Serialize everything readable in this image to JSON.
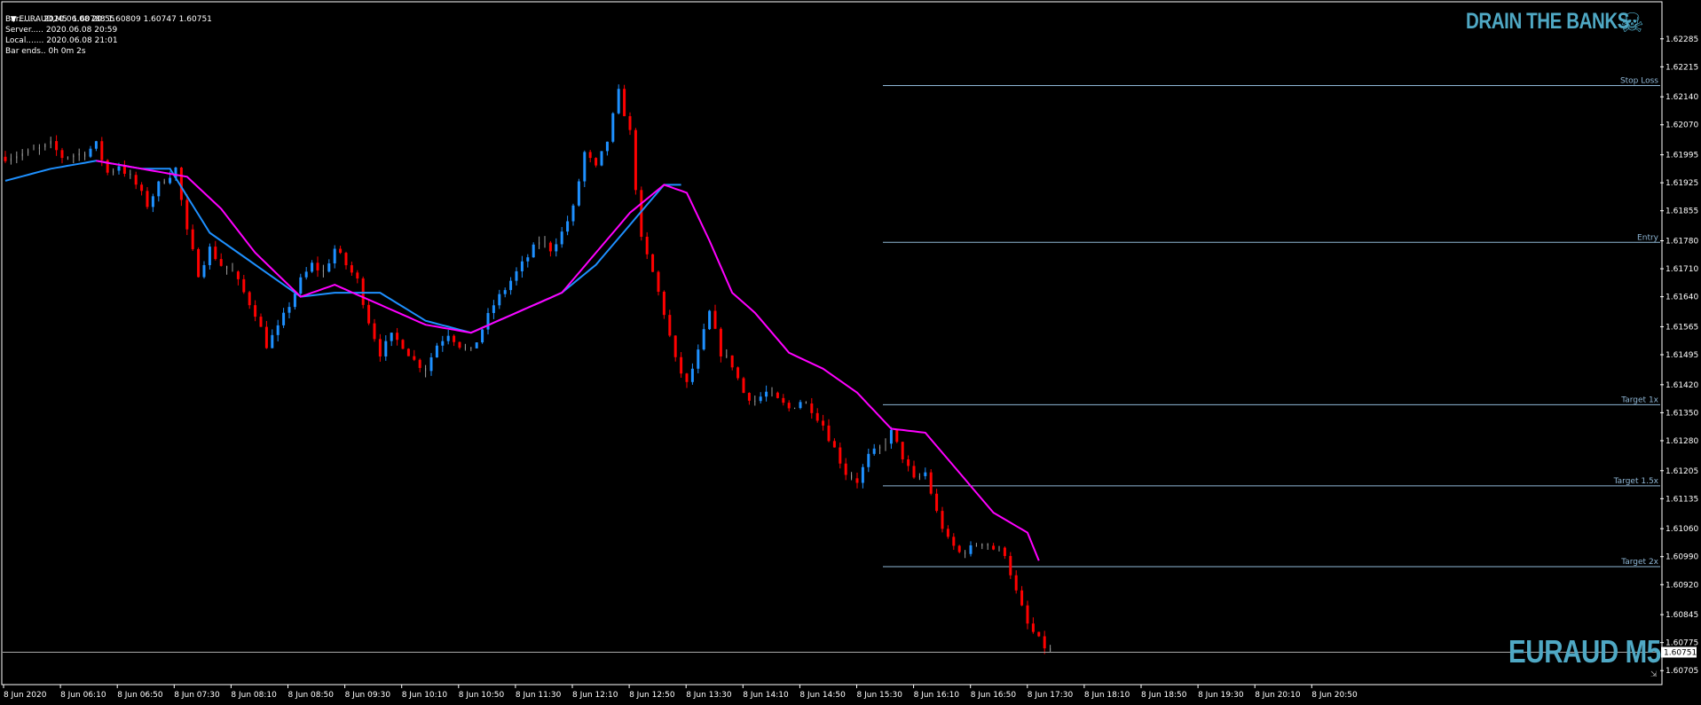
{
  "header": {
    "symbol_line": "EURAUD,M5  1.60788 1.60809 1.60747 1.60751",
    "bar": "Bar......... 2020.06.08 20:55",
    "server": "Server..... 2020.06.08 20:59",
    "local": "Local....... 2020.06.08 21:01",
    "bar_ends": "Bar ends.. 0h 0m 2s"
  },
  "branding": {
    "top": "DRAIN THE BANKS",
    "bottom": "EURAUD M5",
    "icon": "skull-crossbones-icon"
  },
  "colors": {
    "background": "#000000",
    "bull": "#1e90ff",
    "bear": "#ff0000",
    "neutral": "#a0a0a0",
    "ma_fast": "#1e90ff",
    "ma_slow": "#ff00ff",
    "level": "#8fb7d6",
    "brand": "#4fa8c4"
  },
  "chart_data": {
    "type": "candlestick",
    "symbol": "EURAUD",
    "timeframe": "M5",
    "y_ticks": [
      "1.62285",
      "1.62215",
      "1.62140",
      "1.62070",
      "1.61995",
      "1.61925",
      "1.61855",
      "1.61780",
      "1.61710",
      "1.61640",
      "1.61565",
      "1.61495",
      "1.61420",
      "1.61350",
      "1.61280",
      "1.61205",
      "1.61135",
      "1.61060",
      "1.60990",
      "1.60920",
      "1.60845",
      "1.60775",
      "1.60705"
    ],
    "x_ticks": [
      "8 Jun 2020",
      "8 Jun 06:10",
      "8 Jun 06:50",
      "8 Jun 07:30",
      "8 Jun 08:10",
      "8 Jun 08:50",
      "8 Jun 09:30",
      "8 Jun 10:10",
      "8 Jun 10:50",
      "8 Jun 11:30",
      "8 Jun 12:10",
      "8 Jun 12:50",
      "8 Jun 13:30",
      "8 Jun 14:10",
      "8 Jun 14:50",
      "8 Jun 15:30",
      "8 Jun 16:10",
      "8 Jun 16:50",
      "8 Jun 17:30",
      "8 Jun 18:10",
      "8 Jun 18:50",
      "8 Jun 19:30",
      "8 Jun 20:10",
      "8 Jun 20:50"
    ],
    "ylim": [
      1.6069,
      1.6232
    ],
    "current_price": "1.60751",
    "levels": [
      {
        "label": "Stop Loss",
        "price": 1.62168
      },
      {
        "label": "Entry",
        "price": 1.61776
      },
      {
        "label": "Target 1x",
        "price": 1.6137
      },
      {
        "label": "Target 1.5x",
        "price": 1.61167
      },
      {
        "label": "Target 2x",
        "price": 1.60965
      }
    ],
    "close_path": [
      [
        0,
        1.6199
      ],
      [
        4,
        1.62
      ],
      [
        8,
        1.6202
      ],
      [
        10,
        1.6199
      ],
      [
        14,
        1.62
      ],
      [
        16,
        1.6202
      ],
      [
        18,
        1.6195
      ],
      [
        20,
        1.6197
      ],
      [
        23,
        1.6192
      ],
      [
        25,
        1.6187
      ],
      [
        27,
        1.6192
      ],
      [
        30,
        1.6196
      ],
      [
        32,
        1.618
      ],
      [
        34,
        1.617
      ],
      [
        36,
        1.6176
      ],
      [
        38,
        1.6172
      ],
      [
        40,
        1.617
      ],
      [
        42,
        1.6165
      ],
      [
        44,
        1.616
      ],
      [
        46,
        1.6152
      ],
      [
        48,
        1.6156
      ],
      [
        50,
        1.6162
      ],
      [
        52,
        1.6168
      ],
      [
        54,
        1.6172
      ],
      [
        56,
        1.617
      ],
      [
        58,
        1.6176
      ],
      [
        60,
        1.6172
      ],
      [
        62,
        1.6168
      ],
      [
        64,
        1.6158
      ],
      [
        66,
        1.615
      ],
      [
        68,
        1.6154
      ],
      [
        70,
        1.6152
      ],
      [
        72,
        1.6148
      ],
      [
        74,
        1.6146
      ],
      [
        76,
        1.6152
      ],
      [
        78,
        1.6155
      ],
      [
        80,
        1.6152
      ],
      [
        82,
        1.615
      ],
      [
        84,
        1.6156
      ],
      [
        86,
        1.6162
      ],
      [
        88,
        1.6166
      ],
      [
        90,
        1.617
      ],
      [
        92,
        1.6174
      ],
      [
        94,
        1.6178
      ],
      [
        96,
        1.6176
      ],
      [
        98,
        1.618
      ],
      [
        100,
        1.6186
      ],
      [
        102,
        1.62
      ],
      [
        104,
        1.6196
      ],
      [
        106,
        1.6203
      ],
      [
        108,
        1.6215
      ],
      [
        110,
        1.6205
      ],
      [
        112,
        1.6178
      ],
      [
        114,
        1.617
      ],
      [
        116,
        1.616
      ],
      [
        118,
        1.6148
      ],
      [
        120,
        1.6142
      ],
      [
        122,
        1.615
      ],
      [
        124,
        1.616
      ],
      [
        126,
        1.615
      ],
      [
        128,
        1.6147
      ],
      [
        130,
        1.614
      ],
      [
        132,
        1.6138
      ],
      [
        134,
        1.614
      ],
      [
        136,
        1.6138
      ],
      [
        138,
        1.6136
      ],
      [
        140,
        1.6138
      ],
      [
        142,
        1.6136
      ],
      [
        144,
        1.6132
      ],
      [
        146,
        1.6126
      ],
      [
        148,
        1.612
      ],
      [
        150,
        1.6118
      ],
      [
        152,
        1.6124
      ],
      [
        154,
        1.6126
      ],
      [
        156,
        1.613
      ],
      [
        158,
        1.6124
      ],
      [
        160,
        1.6118
      ],
      [
        162,
        1.612
      ],
      [
        164,
        1.611
      ],
      [
        166,
        1.6103
      ],
      [
        168,
        1.61
      ],
      [
        170,
        1.6101
      ],
      [
        172,
        1.6103
      ],
      [
        174,
        1.6101
      ],
      [
        176,
        1.61
      ],
      [
        178,
        1.609
      ],
      [
        180,
        1.6082
      ],
      [
        182,
        1.6078
      ],
      [
        184,
        1.6075
      ]
    ],
    "ma_fast_path": [
      [
        0,
        1.6193
      ],
      [
        8,
        1.6196
      ],
      [
        16,
        1.6198
      ],
      [
        24,
        1.6196
      ],
      [
        29,
        1.6196
      ],
      [
        36,
        1.618
      ],
      [
        44,
        1.6172
      ],
      [
        52,
        1.6164
      ],
      [
        58,
        1.6165
      ],
      [
        66,
        1.6165
      ],
      [
        74,
        1.6158
      ],
      [
        82,
        1.6155
      ],
      [
        90,
        1.616
      ],
      [
        98,
        1.6165
      ],
      [
        104,
        1.6172
      ],
      [
        110,
        1.6182
      ],
      [
        116,
        1.6192
      ],
      [
        119,
        1.6192
      ]
    ],
    "ma_slow_path": [
      [
        16,
        1.6198
      ],
      [
        24,
        1.6196
      ],
      [
        32,
        1.6194
      ],
      [
        38,
        1.6186
      ],
      [
        44,
        1.6175
      ],
      [
        52,
        1.6164
      ],
      [
        58,
        1.6167
      ],
      [
        66,
        1.6162
      ],
      [
        74,
        1.6157
      ],
      [
        82,
        1.6155
      ],
      [
        90,
        1.616
      ],
      [
        98,
        1.6165
      ],
      [
        104,
        1.6175
      ],
      [
        110,
        1.6185
      ],
      [
        116,
        1.6192
      ],
      [
        120,
        1.619
      ],
      [
        124,
        1.6178
      ],
      [
        128,
        1.6165
      ],
      [
        132,
        1.616
      ],
      [
        138,
        1.615
      ],
      [
        144,
        1.6146
      ],
      [
        150,
        1.614
      ],
      [
        156,
        1.6131
      ],
      [
        162,
        1.613
      ],
      [
        168,
        1.612
      ],
      [
        174,
        1.611
      ],
      [
        180,
        1.6105
      ],
      [
        182,
        1.6098
      ]
    ]
  }
}
